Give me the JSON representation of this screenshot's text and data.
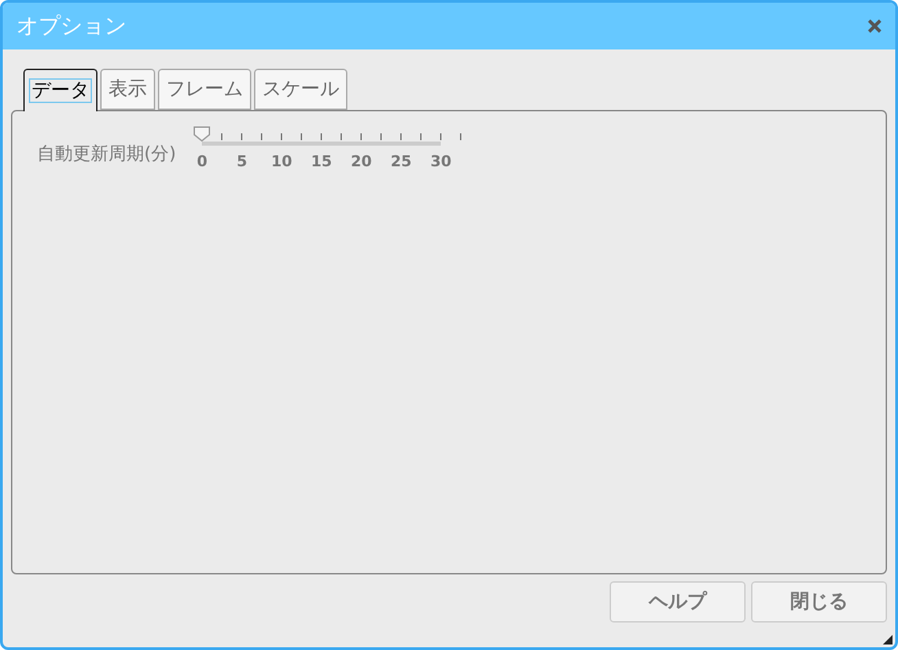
{
  "window": {
    "title": "オプション"
  },
  "tabs": [
    {
      "label": "データ",
      "selected": true
    },
    {
      "label": "表示",
      "selected": false
    },
    {
      "label": "フレーム",
      "selected": false
    },
    {
      "label": "スケール",
      "selected": false
    }
  ],
  "slider": {
    "label": "自動更新周期(分)",
    "level": 0,
    "tick_labels": [
      "0",
      "5",
      "10",
      "15",
      "20",
      "25",
      "30"
    ]
  },
  "buttons": [
    "ヘルプ",
    "閉じる"
  ]
}
